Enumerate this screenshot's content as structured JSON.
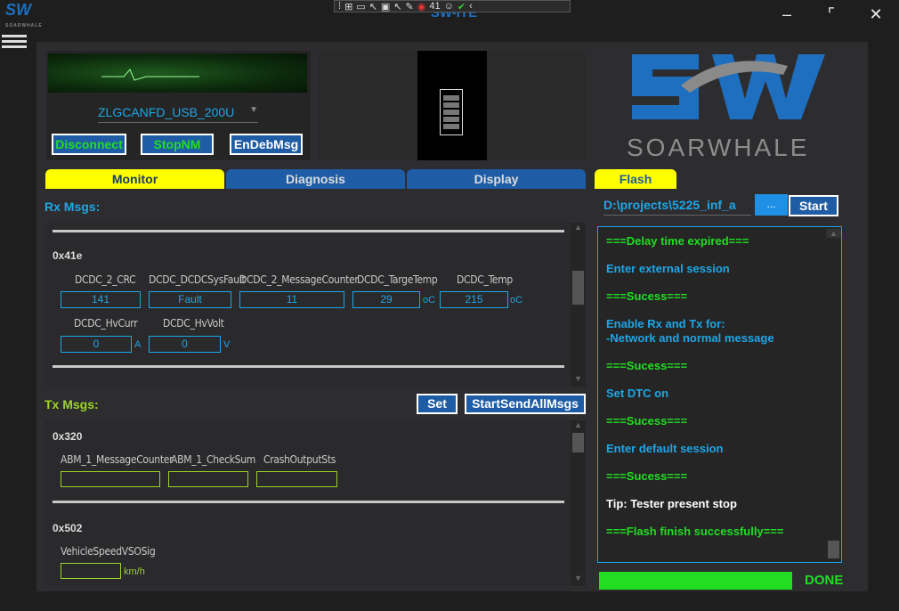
{
  "window": {
    "title": "SW-ITE",
    "logo_text": "SW",
    "logo_sub": "SOARWHALE"
  },
  "system_toolbar": {
    "notification_count": "41"
  },
  "connection": {
    "device": "ZLGCANFD_USB_200U",
    "disconnect_label": "Disconnect",
    "stopnm_label": "StopNM",
    "endebmsg_label": "EnDebMsg"
  },
  "brand": {
    "name": "SOARWHALE"
  },
  "tabs": {
    "monitor": "Monitor",
    "diagnosis": "Diagnosis",
    "display": "Display",
    "flash": "Flash"
  },
  "rx": {
    "title": "Rx Msgs:",
    "message_id": "0x41e",
    "signals": [
      {
        "name": "DCDC_2_CRC",
        "value": "141",
        "unit": ""
      },
      {
        "name": "DCDC_DCDCSysFault",
        "value": "Fault",
        "unit": ""
      },
      {
        "name": "DCDC_2_MessageCounter",
        "value": "11",
        "unit": ""
      },
      {
        "name": "DCDC_TargeTemp",
        "value": "29",
        "unit": "oC"
      },
      {
        "name": "DCDC_Temp",
        "value": "215",
        "unit": "oC"
      },
      {
        "name": "DCDC_HvCurr",
        "value": "0",
        "unit": "A"
      },
      {
        "name": "DCDC_HvVolt",
        "value": "0",
        "unit": "V"
      }
    ]
  },
  "tx": {
    "title": "Tx Msgs:",
    "set_label": "Set",
    "send_all_label": "StartSendAllMsgs",
    "msg1_id": "0x320",
    "msg1_signals": [
      "ABM_1_MessageCounter",
      "ABM_1_CheckSum",
      "CrashOutputSts"
    ],
    "msg2_id": "0x502",
    "msg2_signal": "VehicleSpeedVSOSig",
    "msg2_unit": "km/h"
  },
  "flash": {
    "path": "D:\\projects\\5225_inf_a",
    "browse_label": "...",
    "start_label": "Start",
    "log": [
      {
        "text": "===Delay time expired===",
        "color": "#22dd22"
      },
      {
        "text": "Enter external session",
        "color": "#1ea6e6"
      },
      {
        "text": "===Sucess===",
        "color": "#22dd22"
      },
      {
        "text": "Enable Rx and Tx for:\n-Network and normal message",
        "color": "#1ea6e6"
      },
      {
        "text": "===Sucess===",
        "color": "#22dd22"
      },
      {
        "text": "Set DTC on",
        "color": "#1ea6e6"
      },
      {
        "text": "===Sucess===",
        "color": "#22dd22"
      },
      {
        "text": "Enter default session",
        "color": "#1ea6e6"
      },
      {
        "text": "===Sucess===",
        "color": "#22dd22"
      },
      {
        "text": "Tip: Tester present stop",
        "color": "#ffffff"
      },
      {
        "text": "===Flash finish successfully===",
        "color": "#22dd22"
      }
    ],
    "progress": 1.0,
    "status": "DONE"
  },
  "colors": {
    "accent": "#1e5da6",
    "tab_active": "#ffff00",
    "ok": "#22dd22",
    "cyan": "#1ea6e6"
  }
}
